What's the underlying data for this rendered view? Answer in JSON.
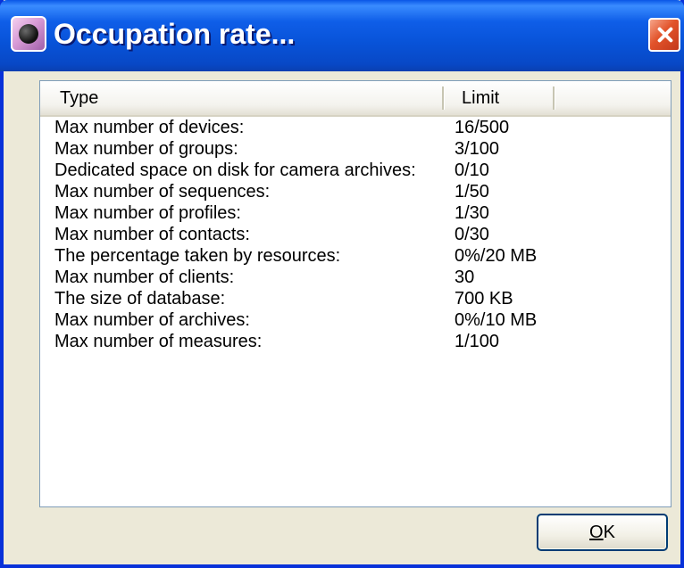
{
  "window": {
    "title": "Occupation rate...",
    "app_icon": "webcam-icon",
    "close_icon": "close-icon"
  },
  "list": {
    "columns": [
      "Type",
      "Limit"
    ],
    "rows": [
      {
        "type": "Max number of devices:",
        "limit": "16/500"
      },
      {
        "type": "Max number of groups:",
        "limit": "3/100"
      },
      {
        "type": "Dedicated space on disk for camera archives:",
        "limit": "0/10"
      },
      {
        "type": "Max number of sequences:",
        "limit": "1/50"
      },
      {
        "type": "Max number of profiles:",
        "limit": "1/30"
      },
      {
        "type": "Max number of contacts:",
        "limit": "0/30"
      },
      {
        "type": "The percentage taken by resources:",
        "limit": "0%/20 MB"
      },
      {
        "type": "Max number of clients:",
        "limit": "30"
      },
      {
        "type": "The size of database:",
        "limit": "700 KB"
      },
      {
        "type": "Max number of archives:",
        "limit": "0%/10 MB"
      },
      {
        "type": "Max number of measures:",
        "limit": "1/100"
      }
    ]
  },
  "buttons": {
    "ok_accel": "O",
    "ok_rest": "K"
  },
  "colors": {
    "titlebar": "#0a56e6",
    "close": "#e2532a",
    "face": "#ece9d8"
  }
}
